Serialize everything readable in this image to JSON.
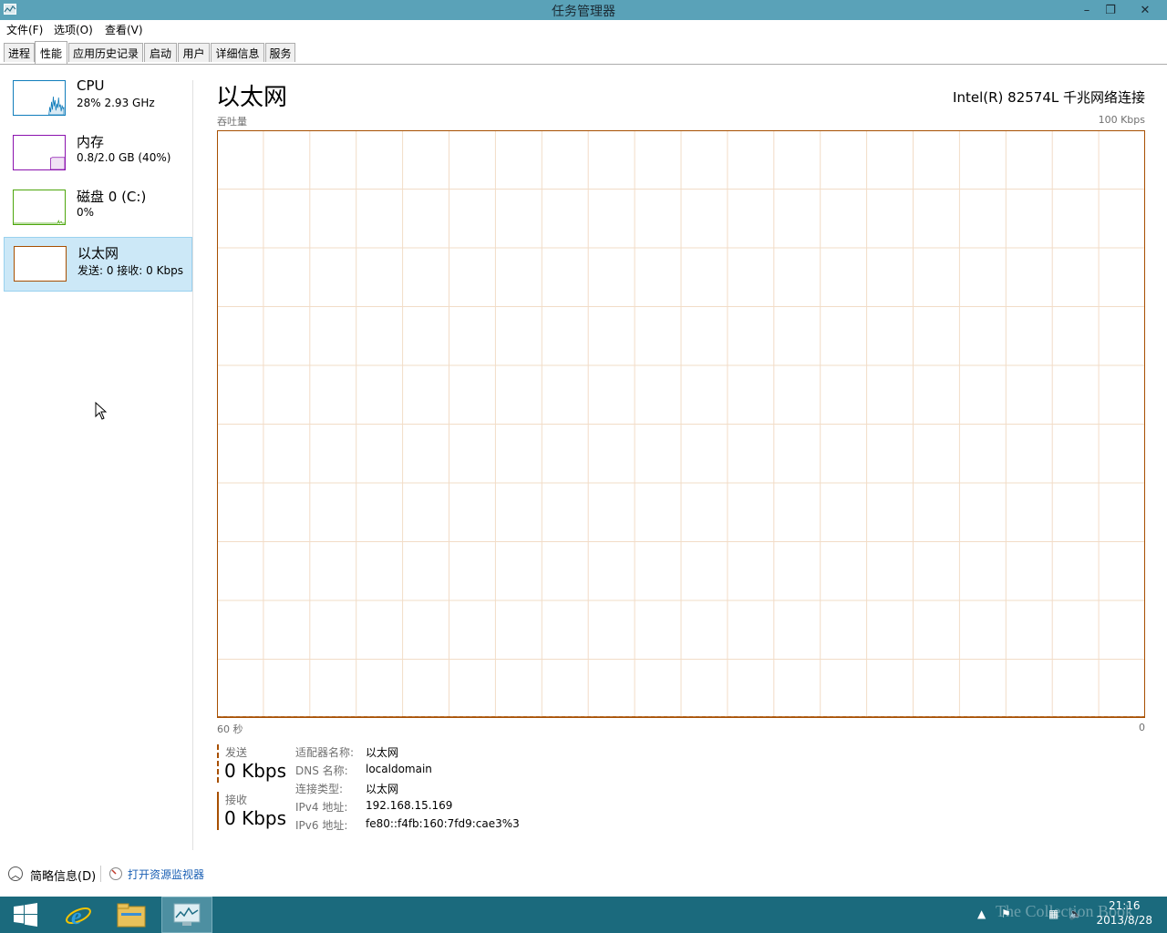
{
  "window": {
    "title": "任务管理器",
    "min_label": "–",
    "max_label": "❐",
    "close_label": "✕"
  },
  "menu": [
    "文件(F)",
    "选项(O)",
    "查看(V)"
  ],
  "tabs": [
    "进程",
    "性能",
    "应用历史记录",
    "启动",
    "用户",
    "详细信息",
    "服务"
  ],
  "active_tab": "性能",
  "sidebar": {
    "items": [
      {
        "name": "CPU",
        "sub": "28% 2.93 GHz",
        "color": "#117dbb"
      },
      {
        "name": "内存",
        "sub": "0.8/2.0 GB (40%)",
        "color": "#8b12ae"
      },
      {
        "name": "磁盘 0 (C:)",
        "sub": "0%",
        "color": "#4da60c"
      },
      {
        "name": "以太网",
        "sub": "发送: 0 接收: 0 Kbps",
        "color": "#a74f01"
      }
    ],
    "cpu_usage_pct": 28,
    "memory_usage_pct": 40,
    "selected": "以太网"
  },
  "main": {
    "title": "以太网",
    "adapter": "Intel(R) 82574L 千兆网络连接",
    "graph_label": "吞吐量",
    "graph_max": "100 Kbps",
    "x_left": "60 秒",
    "x_right": "0",
    "grid_color": "#f2dcc7",
    "border_color": "#a74f01"
  },
  "chart_data": {
    "type": "line",
    "title": "",
    "ylabel": "吞吐量",
    "ylim": [
      0,
      100
    ],
    "xlim": [
      60,
      0
    ],
    "series": [
      {
        "name": "发送",
        "values": [
          0,
          0
        ]
      },
      {
        "name": "接收",
        "values": [
          0,
          0
        ]
      }
    ],
    "grid": true
  },
  "stats": {
    "send_label": "发送",
    "send_value": "0 Kbps",
    "recv_label": "接收",
    "recv_value": "0 Kbps"
  },
  "info": [
    {
      "key": "适配器名称:",
      "value": "以太网"
    },
    {
      "key": "DNS 名称:",
      "value": "localdomain"
    },
    {
      "key": "连接类型:",
      "value": "以太网"
    },
    {
      "key": "IPv4 地址:",
      "value": "192.168.15.169"
    },
    {
      "key": "IPv6 地址:",
      "value": "fe80::f4fb:160:7fd9:cae3%3"
    }
  ],
  "footer": {
    "brief": "简略信息(D)",
    "monitor": "打开资源监视器"
  },
  "taskbar": {
    "time": "21:16",
    "date": "2013/8/28",
    "watermark": "The Collection Book"
  }
}
